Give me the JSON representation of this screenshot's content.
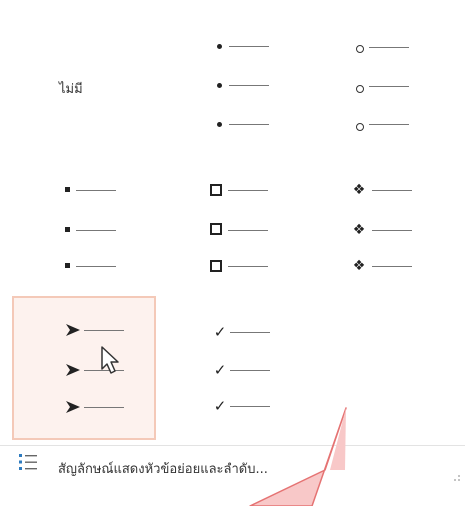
{
  "gallery": {
    "none_label": "ไม่มี",
    "bullets": [
      {
        "name": "bullet-dot",
        "symbol": "•"
      },
      {
        "name": "bullet-ring",
        "symbol": "○"
      },
      {
        "name": "bullet-small-square",
        "symbol": "■"
      },
      {
        "name": "bullet-hollow-square",
        "symbol": "❑"
      },
      {
        "name": "bullet-diamond",
        "symbol": "❖"
      },
      {
        "name": "bullet-arrowhead",
        "symbol": "➢"
      },
      {
        "name": "bullet-checkmark",
        "symbol": "✓"
      }
    ],
    "selected": "bullet-arrowhead"
  },
  "footer": {
    "label": "สัญลักษณ์แสดงหัวข้อย่อยและลำดับ...",
    "icon": "list-icon"
  },
  "colors": {
    "selected_bg": "#fdf2ee",
    "selected_border": "#f4c9b8",
    "callout_fill": "#f8c8c8",
    "callout_stroke": "#e57373"
  }
}
